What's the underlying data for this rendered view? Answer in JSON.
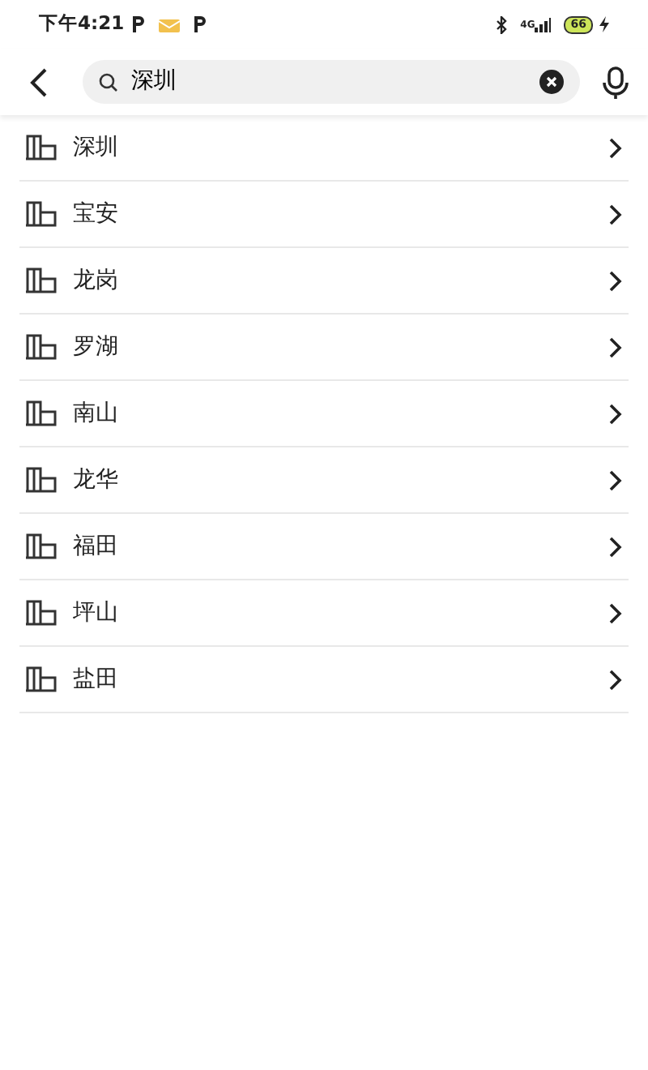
{
  "status_bar": {
    "time": "下午4:21",
    "network": "4G",
    "battery": "66"
  },
  "search": {
    "value": "深圳"
  },
  "results": [
    {
      "label": "深圳"
    },
    {
      "label": "宝安"
    },
    {
      "label": "龙岗"
    },
    {
      "label": "罗湖"
    },
    {
      "label": "南山"
    },
    {
      "label": "龙华"
    },
    {
      "label": "福田"
    },
    {
      "label": "坪山"
    },
    {
      "label": "盐田"
    }
  ]
}
